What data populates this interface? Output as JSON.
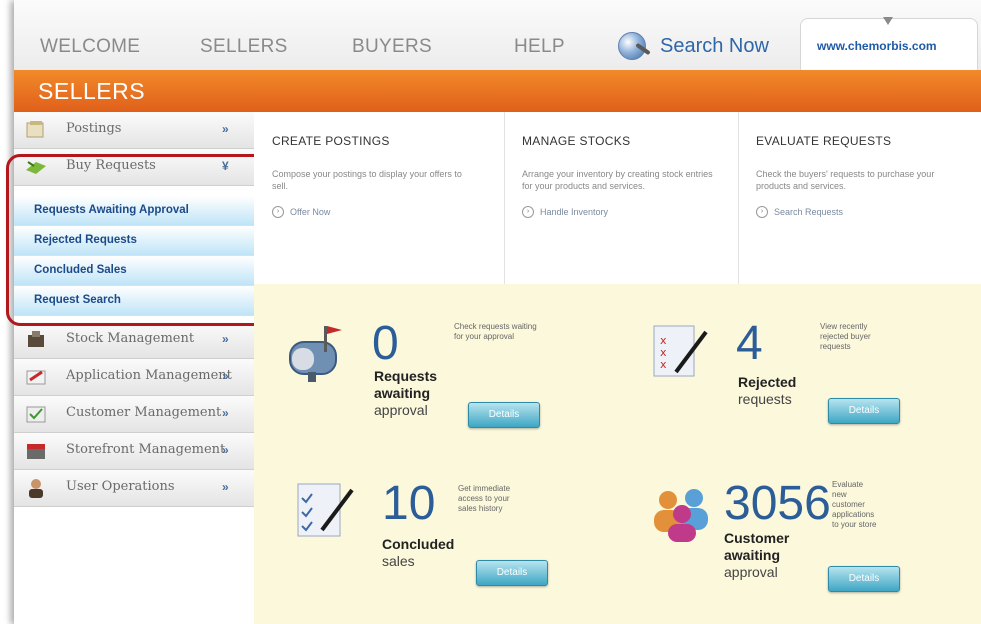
{
  "nav": {
    "items": [
      "WELCOME",
      "SELLERS",
      "BUYERS",
      "HELP"
    ],
    "search_label": "Search Now",
    "url": "www.chemorbis.com"
  },
  "section_title": "SELLERS",
  "sidebar": {
    "items": [
      {
        "label": "Postings",
        "chevron": "»",
        "icon": "postings-icon"
      },
      {
        "label": "Buy Requests",
        "chevron": "¥",
        "icon": "buy-requests-icon"
      },
      {
        "label": "Stock Management",
        "chevron": "»",
        "icon": "stock-icon"
      },
      {
        "label": "Application Management",
        "chevron": "»",
        "icon": "application-icon"
      },
      {
        "label": "Customer Management",
        "chevron": "»",
        "icon": "customer-icon"
      },
      {
        "label": "Storefront Management",
        "chevron": "»",
        "icon": "storefront-icon"
      },
      {
        "label": "User Operations",
        "chevron": "»",
        "icon": "user-icon"
      }
    ],
    "subitems": [
      "Requests Awaiting Approval",
      "Rejected Requests",
      "Concluded Sales",
      "Request Search"
    ]
  },
  "panels": [
    {
      "title": "CREATE POSTINGS",
      "desc": "Compose your postings to display your offers to sell.",
      "link": "Offer Now"
    },
    {
      "title": "MANAGE STOCKS",
      "desc": "Arrange your inventory by creating stock entries for your products and services.",
      "link": "Handle Inventory"
    },
    {
      "title": "EVALUATE REQUESTS",
      "desc": "Check the buyers' requests to purchase your products and services.",
      "link": "Search Requests"
    }
  ],
  "cards": [
    {
      "number": "0",
      "desc": "Check requests waiting for your approval",
      "bold": "Requests awaiting",
      "rest": "approval",
      "button": "Details",
      "icon": "mailbox-icon"
    },
    {
      "number": "4",
      "desc": "View recently rejected buyer requests",
      "bold": "Rejected",
      "rest": " requests",
      "button": "Details",
      "icon": "rejected-list-icon"
    },
    {
      "number": "10",
      "desc": "Get immediate access to your sales history",
      "bold": "Concluded",
      "rest": " sales",
      "button": "Details",
      "icon": "checklist-icon"
    },
    {
      "number": "3056",
      "desc": "Evaluate new customer applications to your store",
      "bold": "Customer awaiting",
      "rest": "approval",
      "button": "Details",
      "icon": "people-icon"
    }
  ],
  "colors": {
    "orange": "#e9731f",
    "link_blue": "#1c4a8a",
    "number_blue": "#2b5d98",
    "highlight_red": "#b3171c",
    "dash_bg": "#fbf8dc"
  }
}
